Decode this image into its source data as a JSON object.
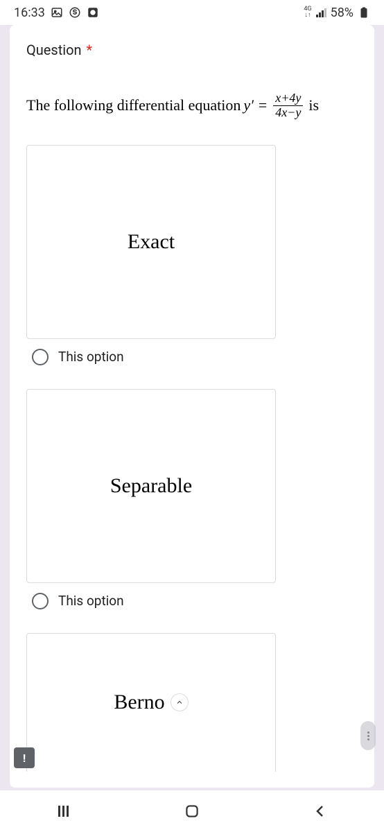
{
  "statusBar": {
    "time": "16:33",
    "networkType": "4G",
    "battery": "58%"
  },
  "question": {
    "label": "Question",
    "requiredMark": "*",
    "equationPrefix": "The following differential equation",
    "equationVar": "y′ =",
    "numerator": "x+4y",
    "denominator": "4x−y",
    "equationSuffix": "is"
  },
  "options": [
    {
      "cardText": "Exact",
      "radioLabel": "This option"
    },
    {
      "cardText": "Separable",
      "radioLabel": "This option"
    },
    {
      "cardText": "Berno",
      "radioLabel": ""
    }
  ],
  "floating": {
    "reportLabel": "!"
  }
}
